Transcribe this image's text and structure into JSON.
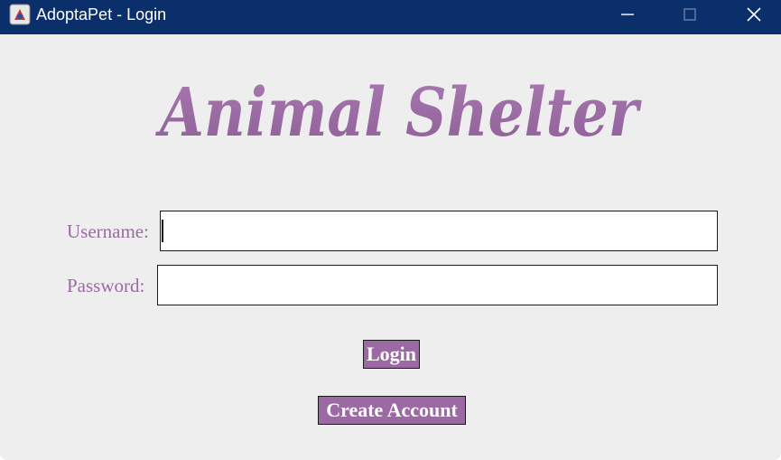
{
  "window": {
    "title": "AdoptaPet - Login"
  },
  "header": {
    "logo_text": "Animal Shelter"
  },
  "form": {
    "username_label": "Username:",
    "username_value": "",
    "password_label": "Password:",
    "password_value": ""
  },
  "actions": {
    "login_label": "Login",
    "create_account_label": "Create Account"
  },
  "colors": {
    "titlebar": "#0b2f6b",
    "accent": "#9b6aa3",
    "background": "#efeeef"
  },
  "icons": {
    "app": "java-app-icon",
    "minimize": "minimize-icon",
    "maximize": "maximize-icon",
    "close": "close-icon"
  }
}
